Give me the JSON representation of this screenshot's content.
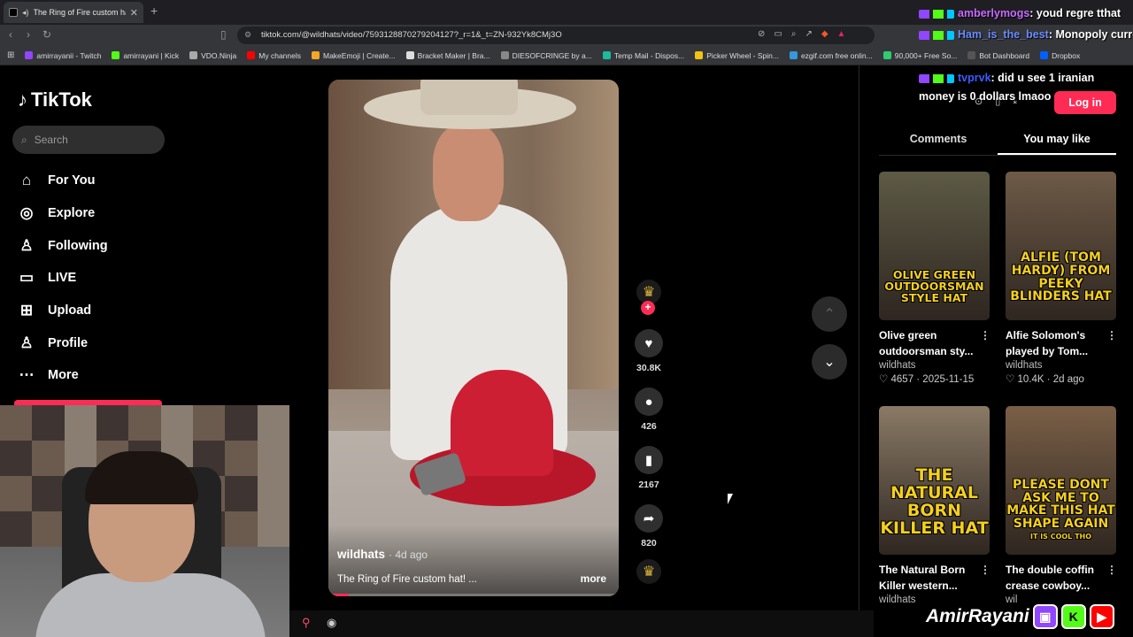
{
  "browser": {
    "tab_title": "The Ring of Fire custom hat!",
    "url": "tiktok.com/@wildhats/video/7593128870279204127?_r=1&_t=ZN-932Yk8CMj3O",
    "bookmarks": [
      {
        "label": "amirrayanii - Twitch",
        "color": "#9146ff"
      },
      {
        "label": "amirrayani | Kick",
        "color": "#53fc18"
      },
      {
        "label": "VDO.Ninja",
        "color": "#aaaaaa"
      },
      {
        "label": "My channels",
        "color": "#ff0000"
      },
      {
        "label": "MakeEmoji | Create...",
        "color": "#f5a623"
      },
      {
        "label": "Bracket Maker | Bra...",
        "color": "#dddddd"
      },
      {
        "label": "DIESOFCRINGE by a...",
        "color": "#888888"
      },
      {
        "label": "Temp Mail - Dispos...",
        "color": "#1abc9c"
      },
      {
        "label": "Picker Wheel - Spin...",
        "color": "#f1c40f"
      },
      {
        "label": "ezgif.com free onlin...",
        "color": "#3498db"
      },
      {
        "label": "90,000+ Free So...",
        "color": "#2ecc71"
      },
      {
        "label": "Bot Dashboard",
        "color": "#555555"
      },
      {
        "label": "Dropbox",
        "color": "#0061ff"
      }
    ]
  },
  "tiktok": {
    "logo_text": "TikTok",
    "search_placeholder": "Search",
    "nav": [
      {
        "label": "For You",
        "icon": "home-icon",
        "glyph": "⌂"
      },
      {
        "label": "Explore",
        "icon": "compass-icon",
        "glyph": "◎"
      },
      {
        "label": "Following",
        "icon": "following-icon",
        "glyph": "♙"
      },
      {
        "label": "LIVE",
        "icon": "live-icon",
        "glyph": "▭"
      },
      {
        "label": "Upload",
        "icon": "upload-icon",
        "glyph": "⊞"
      },
      {
        "label": "Profile",
        "icon": "profile-icon",
        "glyph": "♙"
      },
      {
        "label": "More",
        "icon": "more-icon",
        "glyph": "⋯"
      }
    ],
    "video": {
      "author": "wildhats",
      "age": "· 4d ago",
      "caption": "The Ring of Fire custom hat! ...",
      "more_label": "more",
      "progress": 0.07
    },
    "actions": {
      "likes": "30.8K",
      "comments": "426",
      "saves": "2167",
      "shares": "820"
    },
    "panel": {
      "login_label": "Log in",
      "tabs": [
        "Comments",
        "You may like"
      ],
      "active_tab": "You may like"
    },
    "suggestions": [
      {
        "thumb_text": "OLIVE GREEN OUTDOORSMAN STYLE HAT",
        "thumb_sub": "",
        "bg": "#5d5a45",
        "title": "Olive green outdoorsman sty...",
        "author": "wildhats",
        "meta": "♡ 4657 · 2025-11-15"
      },
      {
        "thumb_text": "ALFIE (TOM HARDY) FROM PEEKY BLINDERS HAT",
        "thumb_sub": "",
        "bg": "#6e5a47",
        "title": "Alfie Solomon's played by Tom...",
        "author": "wildhats",
        "meta": "♡ 10.4K · 2d ago"
      },
      {
        "thumb_text": "THE NATURAL BORN KILLER HAT",
        "thumb_sub": "",
        "bg": "#8a7a66",
        "title": "The Natural Born Killer western...",
        "author": "wildhats",
        "meta": ""
      },
      {
        "thumb_text": "PLEASE DONT ASK ME TO MAKE THIS HAT SHAPE AGAIN",
        "thumb_sub": "IT IS COOL THO",
        "bg": "#7a5f47",
        "title": "The double coffin crease cowboy...",
        "author": "wil",
        "meta": ""
      }
    ]
  },
  "chat": [
    {
      "user": "amberlymogs",
      "user_color": "#c86bff",
      "message": ": youd regre tthat"
    },
    {
      "user": "Ham_is_the_best",
      "user_color": "#6a8cff",
      "message": ": Monopoly currency"
    },
    {
      "user": "tvprvk",
      "user_color": "#3b5bff",
      "message": ": did u see 1 iranian money is 0 dollars lmaoo"
    }
  ],
  "stream_overlay": {
    "name": "AmirRayani"
  }
}
